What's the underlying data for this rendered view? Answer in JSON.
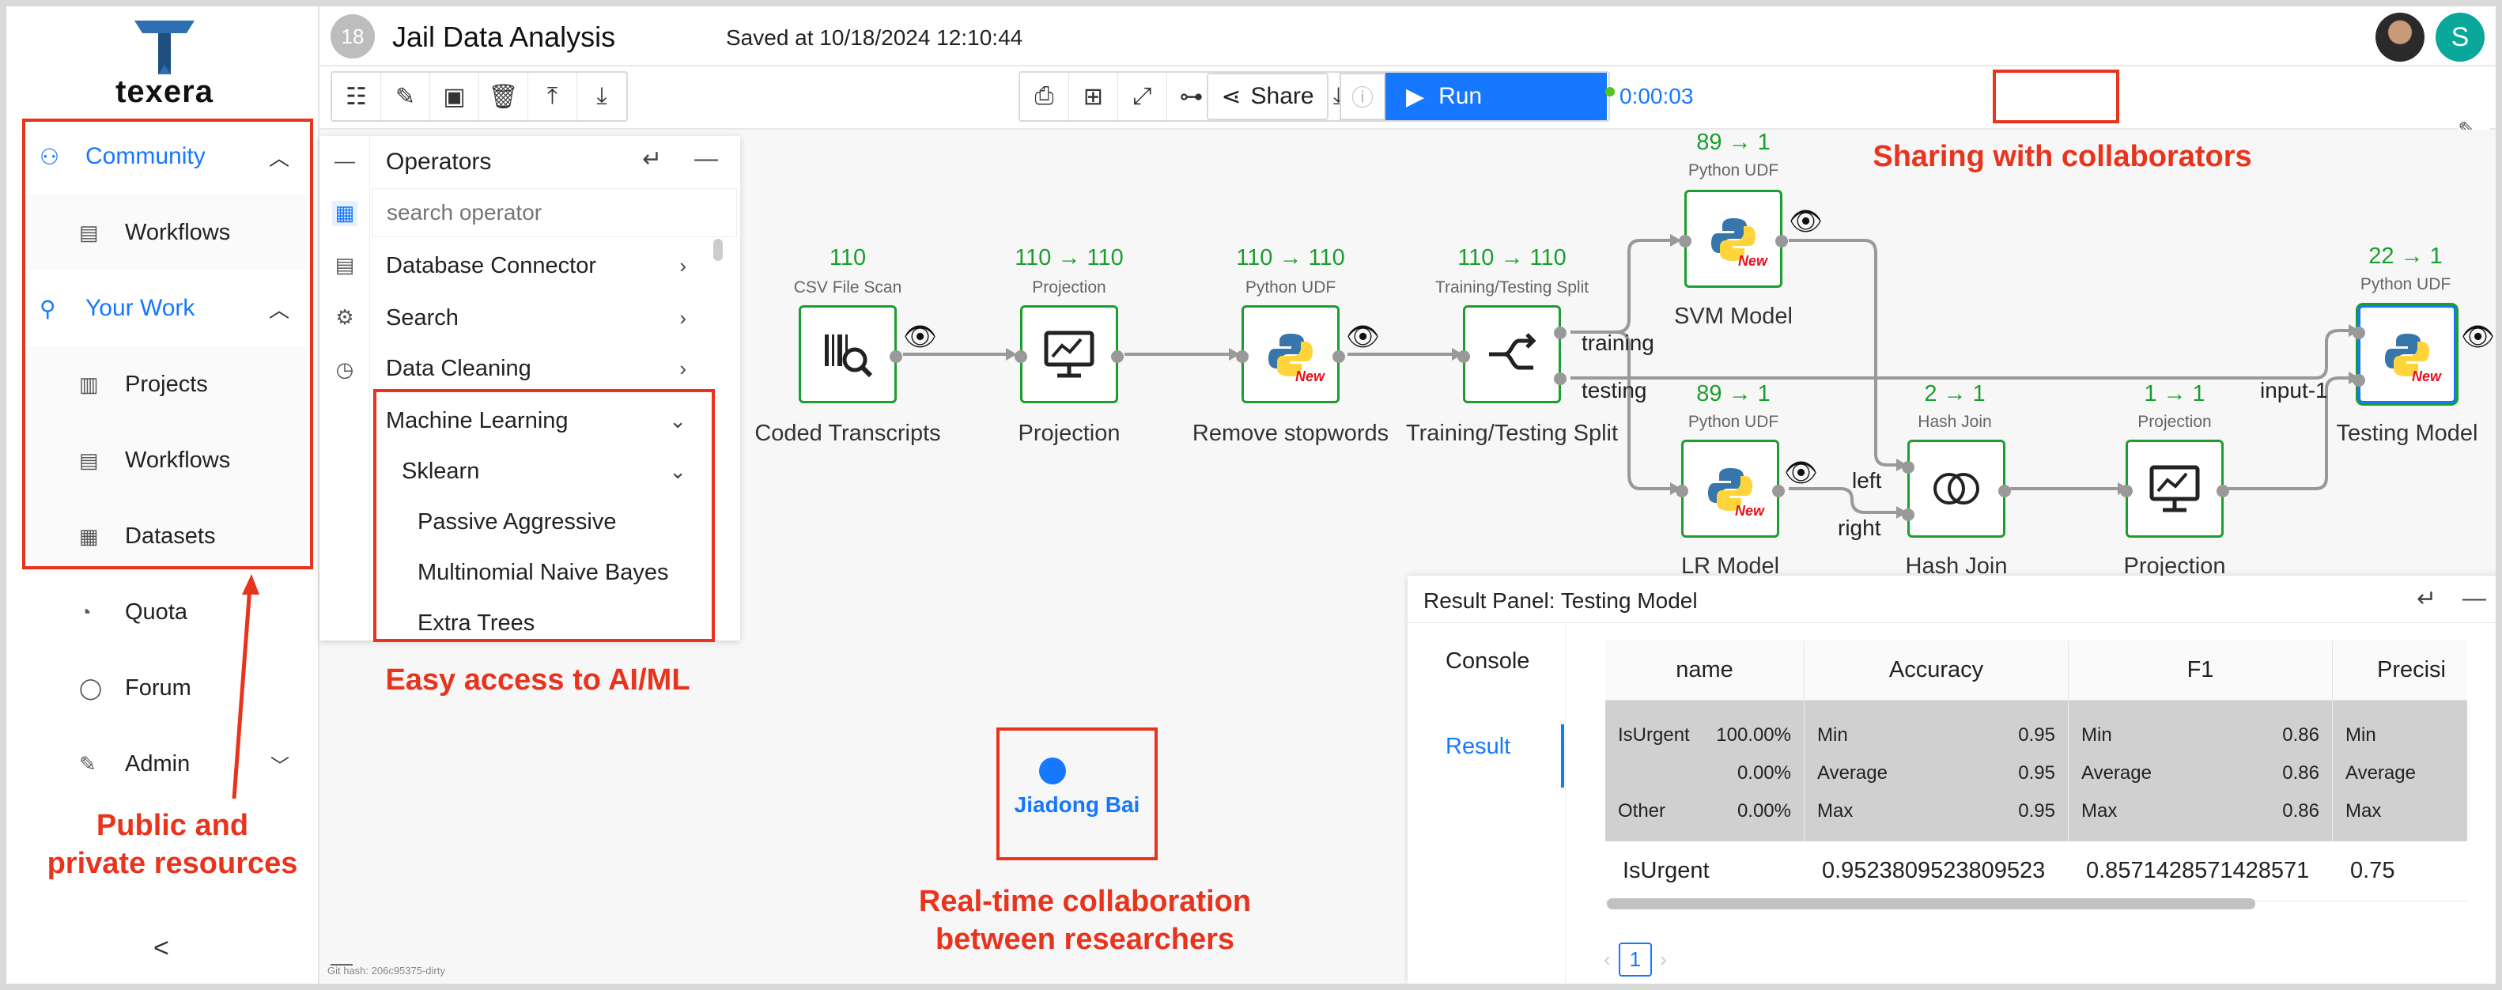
{
  "app": {
    "logo_text": "texera"
  },
  "topbar": {
    "workflow_number": "18",
    "workflow_title": "Jail Data Analysis",
    "saved_text": "Saved at 10/18/2024 12:10:44",
    "user_initial": "S"
  },
  "sidebar": {
    "community": "Community",
    "community_items": [
      "Workflows"
    ],
    "your_work": "Your Work",
    "your_work_items": [
      "Projects",
      "Workflows",
      "Datasets"
    ],
    "other_items": [
      "Quota",
      "Forum",
      "Admin"
    ],
    "collapse_label": "<"
  },
  "toolbar": {
    "share_label": "Share",
    "run_label": "Run",
    "timer": "0:00:03"
  },
  "operators": {
    "title": "Operators",
    "search_placeholder": "search operator",
    "categories": [
      "Database Connector",
      "Search",
      "Data Cleaning",
      "Machine Learning"
    ],
    "subcategory": "Sklearn",
    "items": [
      "Passive Aggressive",
      "Multinomial Naive Bayes",
      "Extra Trees"
    ]
  },
  "workflow": {
    "nodes": [
      {
        "count": "110",
        "type": "CSV File Scan",
        "label": "Coded Transcripts"
      },
      {
        "count": "110 → 110",
        "type": "Projection",
        "label": "Projection"
      },
      {
        "count": "110 → 110",
        "type": "Python UDF",
        "label": "Remove stopwords"
      },
      {
        "count": "110 → 110",
        "type": "Training/Testing Split",
        "label": "Training/Testing Split"
      },
      {
        "count": "89 → 1",
        "type": "Python UDF",
        "label": "SVM Model"
      },
      {
        "count": "89 → 1",
        "type": "Python UDF",
        "label": "LR Model"
      },
      {
        "count": "2 → 1",
        "type": "Hash Join",
        "label": "Hash Join"
      },
      {
        "count": "1 → 1",
        "type": "Projection",
        "label": "Projection"
      },
      {
        "count": "22 → 1",
        "type": "Python UDF",
        "label": "Testing Model"
      }
    ],
    "new_badge": "New",
    "edge_labels": {
      "training": "training",
      "testing": "testing",
      "left": "left",
      "right": "right",
      "input": "input-1"
    }
  },
  "collab": {
    "name": "Jiadong Bai"
  },
  "result_panel": {
    "title": "Result Panel: Testing Model",
    "tabs": [
      "Console",
      "Result"
    ],
    "columns": [
      "name",
      "Accuracy",
      "F1",
      "Precisi"
    ],
    "name_stats": [
      [
        "IsUrgent",
        "100.00%"
      ],
      [
        "",
        "0.00%"
      ],
      [
        "Other",
        "0.00%"
      ]
    ],
    "accuracy_stats": [
      [
        "Min",
        "0.95"
      ],
      [
        "Average",
        "0.95"
      ],
      [
        "Max",
        "0.95"
      ]
    ],
    "f1_stats": [
      [
        "Min",
        "0.86"
      ],
      [
        "Average",
        "0.86"
      ],
      [
        "Max",
        "0.86"
      ]
    ],
    "precision_stats": [
      "Min",
      "Average",
      "Max"
    ],
    "row": [
      "IsUrgent",
      "0.9523809523809523",
      "0.8571428571428571",
      "0.75"
    ],
    "page": "1"
  },
  "annotations": {
    "public_private": "Public and\nprivate resources",
    "ai_ml": "Easy access to AI/ML",
    "realtime": "Real-time collaboration\nbetween researchers",
    "sharing": "Sharing with collaborators"
  },
  "footer": {
    "git_hash": "Git hash: 206c95375-dirty"
  },
  "colors": {
    "accent": "#1677ff",
    "annotation": "#e8331d",
    "node_border": "#1a9e2e"
  }
}
